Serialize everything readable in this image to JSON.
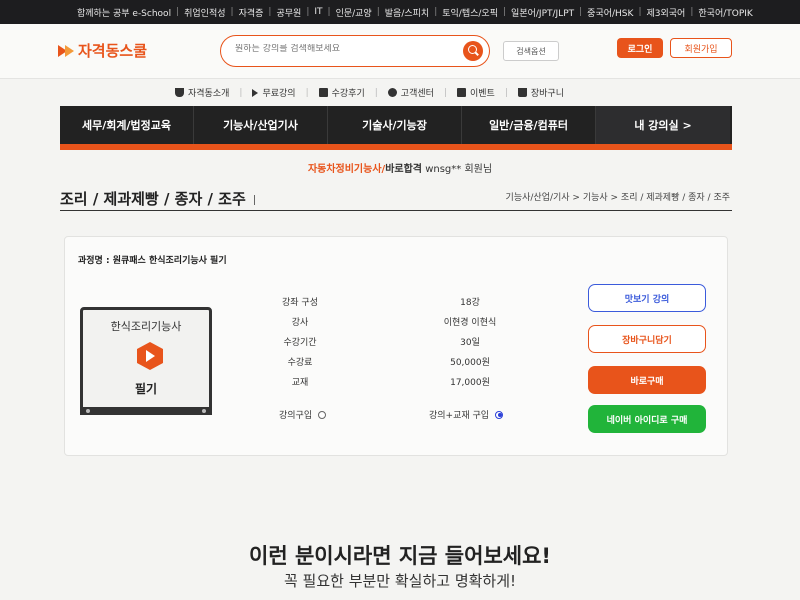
{
  "topbar": {
    "items": [
      "함께하는 공부 e-School",
      "취업인적성",
      "자격증",
      "공무원",
      "IT",
      "인문/교양",
      "발음/스피치",
      "토익/텝스/오픽",
      "일본어/JPT/JLPT",
      "중국어/HSK",
      "제3외국어",
      "한국어/TOPIK"
    ]
  },
  "header": {
    "logo": "자격동스쿨",
    "search_placeholder": "원하는 강의를 검색해보세요",
    "detail_search": "검색옵션",
    "login": "로그인",
    "join": "회원가입"
  },
  "subnav": {
    "items": [
      "자격동소개",
      "무료강의",
      "수강후기",
      "고객센터",
      "이벤트",
      "장바구니"
    ]
  },
  "mainnav": {
    "items": [
      "세무/회계/법정교육",
      "기능사/산업기사",
      "기술사/기능장",
      "일반/금융/컴퓨터",
      "내 강의실 >"
    ]
  },
  "member": {
    "highlight": "자동차정비기능사/",
    "strong": "바로합격",
    "rest": " wnsg** 회원님"
  },
  "page": {
    "title": "조리 / 제과제빵 / 종자 / 조주",
    "breadcrumb": "기능사/산업/기사 > 기능사 > 조리 / 제과제빵 / 종자 / 조주"
  },
  "product": {
    "course_name": "과정명 : 원큐패스 한식조리기능사 필기",
    "thumb_title": "한식조리기능사",
    "thumb_sub": "필기",
    "details": [
      {
        "label": "강좌 구성",
        "value": "18강"
      },
      {
        "label": "강사",
        "value": "이현경 이현식"
      },
      {
        "label": "수강기간",
        "value": "30일"
      },
      {
        "label": "수강료",
        "value": "50,000원"
      },
      {
        "label": "교재",
        "value": "17,000원"
      }
    ],
    "option_lecture": "강의구입",
    "option_lecture_book": "강의+교재 구입",
    "btn_preview": "맛보기 강의",
    "btn_cart": "장바구니담기",
    "btn_buy": "바로구매",
    "btn_naver": "네이버 아이디로 구매"
  },
  "promo": {
    "headline": "이런 분이시라면 지금 들어보세요!",
    "subline": "꼭 필요한 부분만 확실하고 명확하게!"
  },
  "colors": {
    "accent": "#e8541b",
    "naver": "#21b43a",
    "preview": "#3b5bdb"
  }
}
